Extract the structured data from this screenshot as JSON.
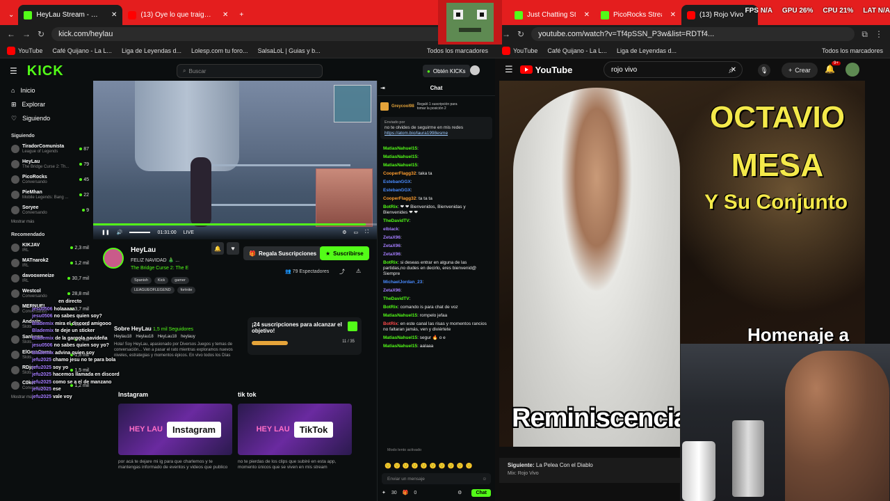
{
  "left_browser": {
    "tabs": [
      {
        "title": "HeyLau Stream - Watch Live",
        "active": true
      },
      {
        "title": "(13) Oye lo que traigo - Arianna",
        "active": false
      }
    ],
    "url": "kick.com/heylau",
    "bookmarks": [
      "YouTube",
      "Café Quijano - La L...",
      "Liga de Leyendas d...",
      "Lolesp.com tu foro...",
      "SalsaLoL | Guias y b...",
      "Todos los marcadores"
    ]
  },
  "right_browser": {
    "tabs": [
      {
        "title": "Just Chatting Streamin",
        "active": false
      },
      {
        "title": "PicoRocks Stream - W",
        "active": false
      },
      {
        "title": "(13) Rojo Vivo",
        "active": true
      }
    ],
    "url": "youtube.com/watch?v=Tf4pSSN_P3w&list=RDTf4...",
    "bookmarks": [
      "YouTube",
      "Café Quijano - La L...",
      "Liga de Leyendas d...",
      "Todos los marcadores"
    ]
  },
  "system": {
    "fps": "FPS N/A",
    "gpu": "GPU 26%",
    "cpu": "CPU 21%",
    "lat": "LAT N/A"
  },
  "kick": {
    "search_placeholder": "Buscar",
    "get_kicks": "Obtén KICKs",
    "nav": [
      "Inicio",
      "Explorar",
      "Siguiendo"
    ],
    "following_label": "Siguiendo",
    "following": [
      {
        "name": "TiradorComunista",
        "game": "League of Legends",
        "count": "87"
      },
      {
        "name": "HeyLau",
        "game": "The Bridge Curse 2: Th...",
        "count": "79"
      },
      {
        "name": "PicoRocks",
        "game": "Conversando",
        "count": "45"
      },
      {
        "name": "PieMhan",
        "game": "Mobile Legends: Bang ...",
        "count": "22"
      },
      {
        "name": "Soryee",
        "game": "Conversando",
        "count": "9"
      }
    ],
    "show_more": "Mostrar más",
    "recommended_label": "Recomendado",
    "recommended": [
      {
        "name": "KIKJAV",
        "game": "IRL",
        "count": "2,3 mil"
      },
      {
        "name": "MATnarok2",
        "game": "IRL",
        "count": "1,2 mil"
      },
      {
        "name": "davooxeneize",
        "game": "IRL",
        "count": "30,7 mil"
      },
      {
        "name": "Westcol",
        "game": "Conversando",
        "count": "28,8 mil"
      },
      {
        "name": "MERNUEL",
        "game": "Conversando",
        "count": "3,7 mil"
      },
      {
        "name": "Andarin",
        "game": "Slots",
        "count": "2,2 mil"
      },
      {
        "name": "Sankawa",
        "game": "Slots",
        "count": "2 mil"
      },
      {
        "name": "ElGeraGarza",
        "game": "Slots",
        "count": "1,8 mil"
      },
      {
        "name": "RDjavi",
        "game": "Slots",
        "count": "1,5 mil"
      },
      {
        "name": "C0ker",
        "game": "Conversando",
        "count": "1,2 mil"
      }
    ],
    "overlay_chat": [
      {
        "user": "",
        "text": "en directo"
      },
      {
        "user": "jesu0506",
        "text": "holaaaaa"
      },
      {
        "user": "jesu0506",
        "text": "no sabes quien soy?"
      },
      {
        "user": "Blademix",
        "text": "mira el discord amigooo"
      },
      {
        "user": "Blademix",
        "text": "te deje un sticker"
      },
      {
        "user": "Blademix",
        "text": "de la gargola navideña"
      },
      {
        "user": "jesu0506",
        "text": "no sabes quien soy yo?"
      },
      {
        "user": "Blademix",
        "text": "advina quien soy"
      },
      {
        "user": "jefu2025",
        "text": "chamo jesu no te para bola"
      },
      {
        "user": "jefu2025",
        "text": "soy yo"
      },
      {
        "user": "jefu2025",
        "text": "hacemos llamada en discord"
      },
      {
        "user": "jefu2025",
        "text": "como se a el de manzano"
      },
      {
        "user": "jefu2025",
        "text": "ese"
      },
      {
        "user": "jefu2025",
        "text": "vale voy"
      }
    ],
    "player": {
      "time": "01:31:00",
      "live": "LIVE",
      "progress": 0.96
    },
    "channel": {
      "name": "HeyLau",
      "title": "FELIZ NAVIDAD 🎄 ...",
      "category": "The Bridge Curse 2: The E",
      "tags": [
        "Spanish",
        "Kick",
        "gamer",
        "LEAGUEOFLEGEND",
        "fortnite"
      ],
      "viewers": "79 Espectadores",
      "gift_label": "Regala Suscripciones",
      "subscribe_label": "Suscribirse"
    },
    "about": {
      "title": "Sobre HeyLau",
      "followers": "1,5 mil Seguidores",
      "socials": [
        "Heylau18",
        "Heylau18",
        "HeyLau18",
        "heylauy"
      ],
      "bio": "Hola! Soy HeyLau, apasionado por Diversos Juegos y temas de conversación... Ven a pasar el rato mientras exploramos nuevos niveles, estrategias y momentos épicos. En vivo todos los Días"
    },
    "goal": {
      "title": "¡24 suscripciones para alcanzar el objetivo!",
      "count": "11 / 35",
      "progress": 0.31
    },
    "panels": [
      {
        "label": "Instagram",
        "logo": "Instagram",
        "desc": "por acá te dejare mi ig para que charlemos y te mantengas informado de eventos y videos que publico"
      },
      {
        "label": "tik tok",
        "logo": "TikTok",
        "desc": "no te pierdas de los clips que subiré en esta app, momento únicos que se viven en mis stream"
      }
    ],
    "chat": {
      "header": "Chat",
      "pinned_user": "Greycool98",
      "pinned_note": "Regaló 1 suscripción para tomar la posición 2",
      "pinned_by": "Enviado por",
      "pinned_text": "no te olvides de seguirme en mis redes",
      "pinned_link": "https://atom.bio/laura1998esme",
      "messages": [
        {
          "user": "MatiasNahuel15",
          "text": "",
          "color": "#53fc18"
        },
        {
          "user": "MatiasNahuel15",
          "text": "",
          "color": "#53fc18"
        },
        {
          "user": "MatiasNahuel15",
          "text": "",
          "color": "#53fc18"
        },
        {
          "user": "CooperFlagg32",
          "text": "taka ta",
          "color": "#ff9d2e"
        },
        {
          "user": "EstebanGGX",
          "text": "",
          "color": "#4a8cff"
        },
        {
          "user": "EstebanGGX",
          "text": "",
          "color": "#4a8cff"
        },
        {
          "user": "CooperFlagg32",
          "text": "ta ta ta",
          "color": "#ff9d2e"
        },
        {
          "user": "BotRix",
          "text": "❤ ❤ Bienvenidos, Bienvenidas y Bienvenides ❤ ❤",
          "color": "#53fc18"
        },
        {
          "user": "TheDavidTV",
          "text": "",
          "color": "#53fc18"
        },
        {
          "user": "elblack",
          "text": "",
          "color": "#a57dff"
        },
        {
          "user": "ZetaX96",
          "text": "",
          "color": "#a57dff"
        },
        {
          "user": "ZetaX96",
          "text": "",
          "color": "#a57dff"
        },
        {
          "user": "ZetaX96",
          "text": "",
          "color": "#a57dff"
        },
        {
          "user": "BotRix",
          "text": "si deseas entrar en alguna de las partidas,no dudes en decirlo, eres bienvenid@ Siempre",
          "color": "#53fc18"
        },
        {
          "user": "MichaelJordan_23",
          "text": "",
          "color": "#4a8cff"
        },
        {
          "user": "ZetaX96",
          "text": "",
          "color": "#a57dff"
        },
        {
          "user": "TheDavidTV",
          "text": "",
          "color": "#53fc18"
        },
        {
          "user": "BotRix",
          "text": "comando is para chat de voz",
          "color": "#53fc18"
        },
        {
          "user": "MatiasNahuel15",
          "text": "rompelo jefaa",
          "color": "#53fc18"
        },
        {
          "user": "BotRix",
          "text": "en este canal las risas y momentos rancios no faltaran jamás, ven y diviértete",
          "color": "#ff4a4a"
        },
        {
          "user": "MatiasNahuel15",
          "text": "segur 🔥 o e",
          "color": "#53fc18"
        },
        {
          "user": "MatiasNahuel15",
          "text": "aalaaa",
          "color": "#53fc18"
        }
      ],
      "mode": "Modo lento activado",
      "input_placeholder": "Enviar un mensaje",
      "points": "30",
      "zero": "0",
      "send": "Chat"
    }
  },
  "youtube": {
    "search": "rojo vivo",
    "create": "Crear",
    "notifications": "9+",
    "video_text": {
      "line1": "OCTAVIO",
      "line2": "MESA",
      "line3": "Y Su Conjunto",
      "line4": "Homenaje a",
      "footer": "Reminiscencias"
    },
    "next_label": "Siguiente:",
    "next_title": "La Pelea Con el Diablo",
    "mix": "Mix: Rojo Vivo"
  }
}
